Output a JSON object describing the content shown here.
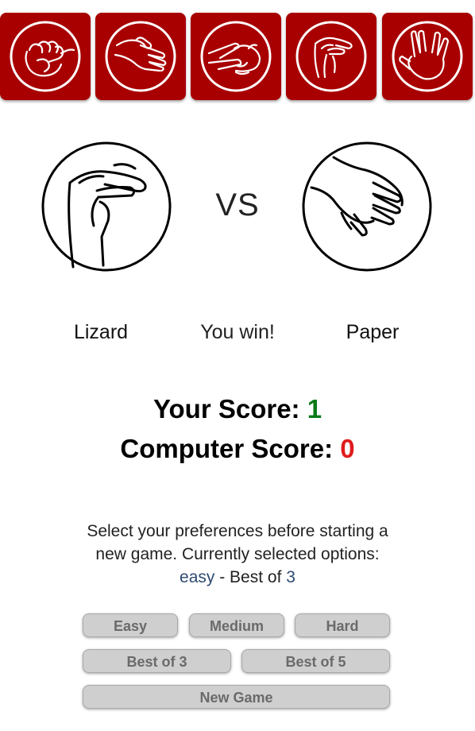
{
  "choices": [
    {
      "name": "Rock",
      "icon": "rock-hand-icon"
    },
    {
      "name": "Paper",
      "icon": "paper-hand-icon"
    },
    {
      "name": "Scissors",
      "icon": "scissors-hand-icon"
    },
    {
      "name": "Lizard",
      "icon": "lizard-hand-icon"
    },
    {
      "name": "Spock",
      "icon": "spock-hand-icon"
    }
  ],
  "colors": {
    "choice_bg": "#a80000",
    "win": "#0a7a17",
    "lose": "#e01b1b",
    "option": "#2f4a72",
    "button_bg": "#cfcfcf"
  },
  "match": {
    "vs_label": "VS",
    "player_choice": "Lizard",
    "player_icon": "lizard-hand-icon",
    "computer_choice": "Paper",
    "computer_icon": "paper-hand-icon",
    "result": "You win!"
  },
  "score": {
    "player_label": "Your Score: ",
    "player_value": "1",
    "computer_label": "Computer Score: ",
    "computer_value": "0"
  },
  "preferences": {
    "text_before": "Select your preferences before starting a new game. Currently selected options: ",
    "difficulty": "easy",
    "separator": " - Best of ",
    "rounds": "3"
  },
  "buttons": {
    "easy": "Easy",
    "medium": "Medium",
    "hard": "Hard",
    "best_of_3": "Best of 3",
    "best_of_5": "Best of 5",
    "new_game": "New Game"
  }
}
